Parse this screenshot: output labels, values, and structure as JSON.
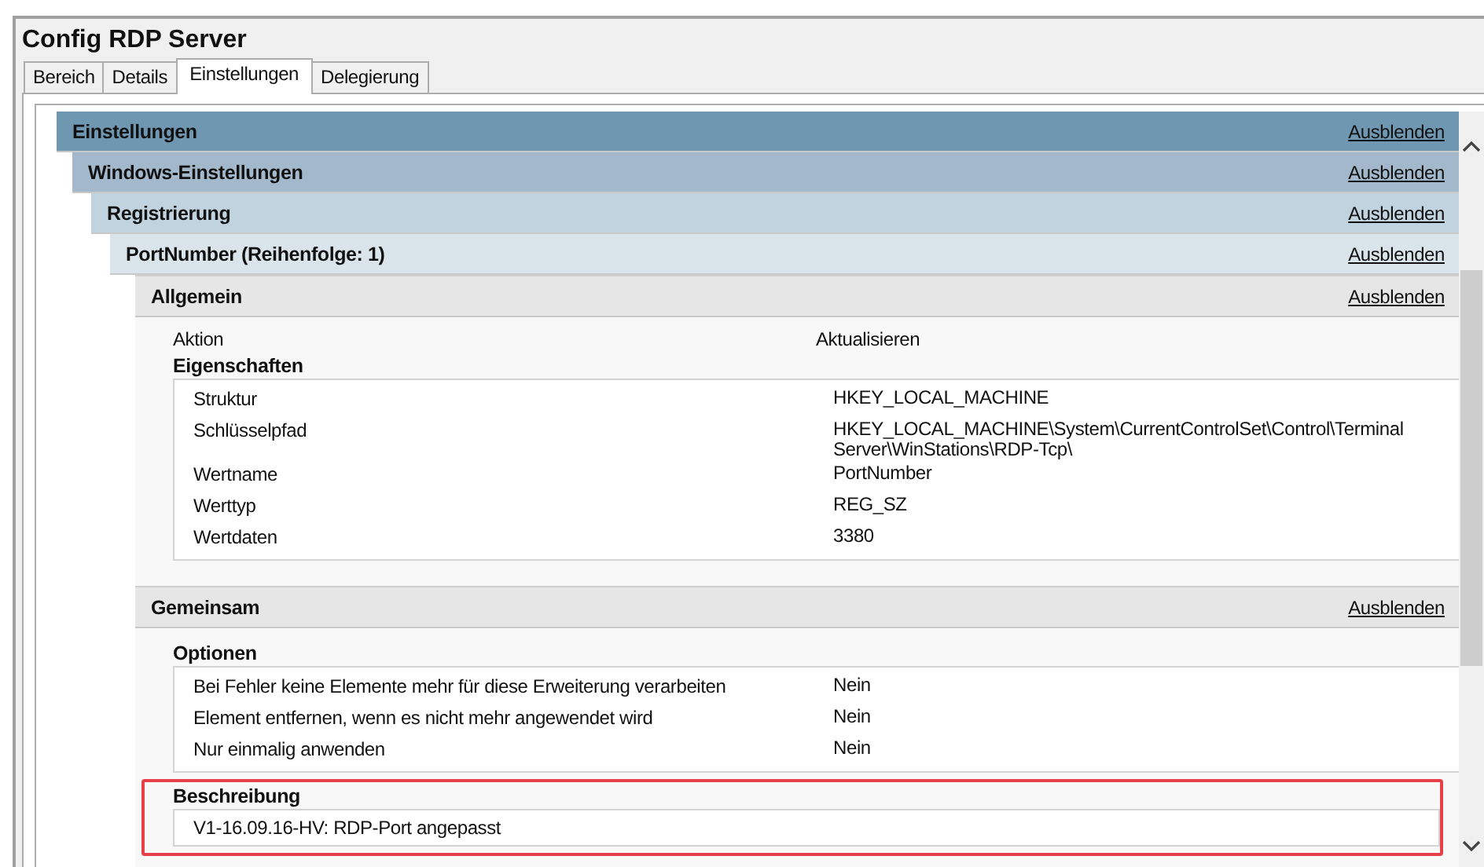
{
  "window": {
    "title": "Config RDP Server"
  },
  "tabs": [
    {
      "label": "Bereich",
      "selected": false
    },
    {
      "label": "Details",
      "selected": false
    },
    {
      "label": "Einstellungen",
      "selected": true
    },
    {
      "label": "Delegierung",
      "selected": false
    }
  ],
  "sections": [
    {
      "title": "Einstellungen",
      "action": "Ausblenden",
      "children": [
        {
          "title": "Windows-Einstellungen",
          "action": "Ausblenden",
          "children": [
            {
              "title": "Registrierung",
              "action": "Ausblenden",
              "children": [
                {
                  "title": "PortNumber (Reihenfolge: 1)",
                  "action": "Ausblenden",
                  "children": [
                    {
                      "title": "Allgemein",
                      "action": "Ausblenden",
                      "content": [
                        {
                          "kind": "field",
                          "label": "Aktion",
                          "value": "Aktualisieren"
                        },
                        {
                          "kind": "table",
                          "title": "Eigenschaften",
                          "highlighted": false,
                          "rows": [
                            {
                              "label": "Struktur",
                              "value": "HKEY_LOCAL_MACHINE"
                            },
                            {
                              "label": "Schlüsselpfad",
                              "value": "HKEY_LOCAL_MACHINE\\System\\CurrentControlSet\\Control\\Terminal Server\\WinStations\\RDP-Tcp\\"
                            },
                            {
                              "label": "Wertname",
                              "value": "PortNumber"
                            },
                            {
                              "label": "Werttyp",
                              "value": "REG_SZ"
                            },
                            {
                              "label": "Wertdaten",
                              "value": "3380"
                            }
                          ]
                        }
                      ]
                    },
                    {
                      "title": "Gemeinsam",
                      "action": "Ausblenden",
                      "content": [
                        {
                          "kind": "table",
                          "title": "Optionen",
                          "highlighted": false,
                          "rows": [
                            {
                              "label": "Bei Fehler keine Elemente mehr für diese Erweiterung verarbeiten",
                              "value": "Nein"
                            },
                            {
                              "label": "Element entfernen, wenn es nicht mehr angewendet wird",
                              "value": "Nein"
                            },
                            {
                              "label": "Nur einmalig anwenden",
                              "value": "Nein"
                            }
                          ]
                        },
                        {
                          "kind": "text",
                          "title": "Beschreibung",
                          "highlighted": true,
                          "text": "V1-16.09.16-HV: RDP-Port angepasst"
                        }
                      ]
                    }
                  ]
                }
              ]
            }
          ]
        }
      ]
    }
  ]
}
